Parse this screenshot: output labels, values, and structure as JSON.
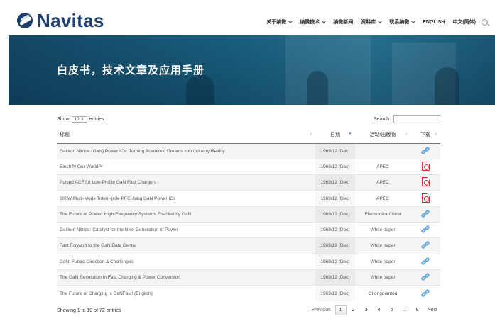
{
  "brand": {
    "name": "Navitas"
  },
  "nav": {
    "items": [
      {
        "label": "关于纳微",
        "dropdown": true
      },
      {
        "label": "纳微技术",
        "dropdown": true
      },
      {
        "label": "纳微新闻",
        "dropdown": false
      },
      {
        "label": "资料库",
        "dropdown": true
      },
      {
        "label": "联系纳微",
        "dropdown": true
      },
      {
        "label": "ENGLISH",
        "dropdown": false
      },
      {
        "label": "中文(简体)",
        "dropdown": false
      }
    ]
  },
  "banner": {
    "title": "白皮书，技术文章及应用手册"
  },
  "table_controls": {
    "show_label": "Show",
    "page_length": "10",
    "entries_label": "entries",
    "search_label": "Search:",
    "search_value": ""
  },
  "table": {
    "columns": [
      "标题",
      "日期",
      "活动/出版物",
      "下载"
    ],
    "rows": [
      {
        "title": "Gallium Nitride (GaN) Power ICs: Turning Academic Dreams into Industry Reality",
        "date": "1969/12 (Dec)",
        "event": "",
        "download": "link-icon"
      },
      {
        "title": "Electrify Our World™",
        "date": "1969/12 (Dec)",
        "event": "APEC",
        "download": "pdf-icon"
      },
      {
        "title": "Pulsed ACF for Low-Profile GaN Fast Chargers",
        "date": "1969/12 (Dec)",
        "event": "APEC",
        "download": "pdf-icon"
      },
      {
        "title": "300W Multi-Mode Totem-pole PFCUsing GaN Power ICs",
        "date": "1969/12 (Dec)",
        "event": "APEC",
        "download": "pdf-icon"
      },
      {
        "title": "The Future of Power: High-Frequency Systems Enabled by GaN",
        "date": "1969/12 (Dec)",
        "event": "Electronica China",
        "download": "link-icon"
      },
      {
        "title": "Gallium Nitride: Catalyst for the Next Generation of Power",
        "date": "1969/12 (Dec)",
        "event": "White paper",
        "download": "link-icon"
      },
      {
        "title": "Fast Forward to the GaN Data Center",
        "date": "1969/12 (Dec)",
        "event": "White paper",
        "download": "link-icon"
      },
      {
        "title": "GaN: Future Direction & Challenges",
        "date": "1969/12 (Dec)",
        "event": "White paper",
        "download": "link-icon"
      },
      {
        "title": "The GaN Revolution In Fast Charging & Power Conversion",
        "date": "1969/12 (Dec)",
        "event": "White paper",
        "download": "link-icon"
      },
      {
        "title": "The Future of Charging is GaNFast! (English)",
        "date": "1969/12 (Dec)",
        "event": "Chongdiantou",
        "download": "link-icon"
      }
    ]
  },
  "footer": {
    "info": "Showing 1 to 10 of 72 entries",
    "pager": [
      "Previous",
      "1",
      "2",
      "3",
      "4",
      "5",
      "...",
      "8",
      "Next"
    ],
    "current_page": "1"
  },
  "colors": {
    "brand": "#1f3f6e",
    "link_icon": "#6aa8d8",
    "pdf_icon": "#d33333",
    "banner": "#1d6a8b"
  }
}
